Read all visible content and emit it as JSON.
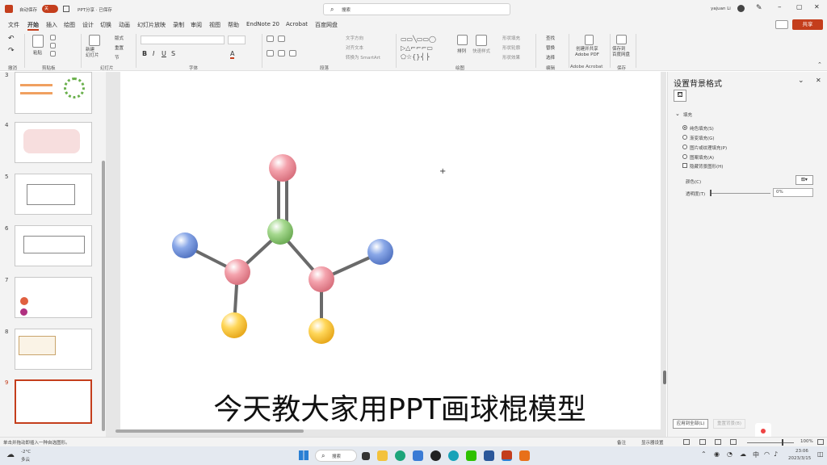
{
  "titlebar": {
    "autosave_label": "自动保存",
    "autosave_toggle": "关",
    "doc_title": "PPT分享 · 已保存",
    "search_placeholder": "搜索",
    "user_name": "yajuan Li"
  },
  "tabs": [
    "文件",
    "开始",
    "插入",
    "绘图",
    "设计",
    "切换",
    "动画",
    "幻灯片放映",
    "录制",
    "审阅",
    "视图",
    "帮助",
    "EndNote 20",
    "Acrobat",
    "百度网盘"
  ],
  "share_label": "共享",
  "ribbon": {
    "groups": [
      "撤消",
      "剪贴板",
      "幻灯片",
      "字体",
      "段落",
      "绘图",
      "编辑",
      "Adobe Acrobat",
      "保存"
    ],
    "paste": "粘贴",
    "new_slide": "新建\n幻灯片",
    "reuse": "重用\n幻灯片",
    "layout": "版式",
    "reset": "重置",
    "section": "节",
    "text_direction": "文字方向",
    "align_text": "对齐文本",
    "smartart": "转换为 SmartArt",
    "arrange": "排列",
    "quick_styles": "快速样式",
    "shape_fill": "形状填充",
    "shape_outline": "形状轮廓",
    "shape_effects": "形状效果",
    "find": "查找",
    "replace": "替换",
    "select": "选择",
    "create_pdf": "创建并共享\nAdobe PDF",
    "save_baidu": "保存到\n百度网盘"
  },
  "slides": {
    "numbers": [
      "3",
      "4",
      "5",
      "6",
      "7",
      "8",
      "9"
    ]
  },
  "slide_caption": "今天教大家用PPT画球棍模型",
  "format_pane": {
    "title": "设置背景格式",
    "section": "填充",
    "options": [
      "纯色填充(S)",
      "渐变填充(G)",
      "图片或纹理填充(P)",
      "图案填充(A)"
    ],
    "checkbox": "隐藏背景图形(H)",
    "color_label": "颜色(C)",
    "transparency_label": "透明度(T)",
    "transparency_value": "0%",
    "apply_all": "应用到全部(L)",
    "reset_bg": "重置背景(B)"
  },
  "status": {
    "hint": "单击并拖动即插入一种自选图形。",
    "notes": "备注",
    "display_settings": "显示器设置",
    "zoom": "100%"
  },
  "taskbar": {
    "weather_temp": "-2°C",
    "weather_text": "多云",
    "search": "搜索",
    "time": "23:06",
    "date": "2023/3/15"
  },
  "colors": {
    "accent": "#c43e1c",
    "ball_pink": "#f4a3ad",
    "ball_green": "#a6d98f",
    "ball_blue": "#8aa8e8",
    "ball_yellow": "#ffd75a"
  }
}
